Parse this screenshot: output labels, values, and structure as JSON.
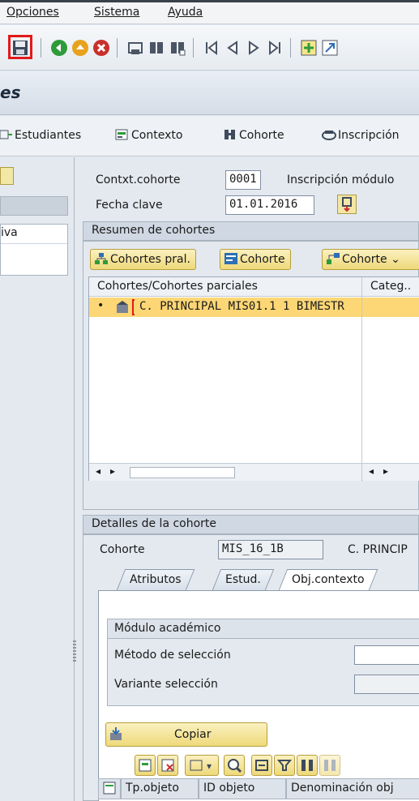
{
  "menu": {
    "items": [
      "Opciones",
      "Sistema",
      "Ayuda"
    ]
  },
  "title": {
    "text": "es"
  },
  "app_toolbar": {
    "estudiantes": "Estudiantes",
    "contexto": "Contexto",
    "cohorte": "Cohorte",
    "inscripcion": "Inscripción"
  },
  "left_pane": {
    "item": "iva"
  },
  "header": {
    "contxt_cohorte_label": "Contxt.cohorte",
    "contxt_cohorte_value": "0001",
    "inscripcion_modulo": "Inscripción módulo",
    "fecha_clave_label": "Fecha clave",
    "fecha_clave_value": "01.01.2016"
  },
  "resumen": {
    "title": "Resumen de cohortes",
    "buttons": {
      "cohortes_pral": "Cohortes pral.",
      "cohorte": "Cohorte",
      "cohorte2": "Cohorte"
    },
    "columns": [
      "Cohortes/Cohortes parciales",
      "Categ.."
    ],
    "row": "C. PRINCIPAL MIS01.1 1 BIMESTR"
  },
  "detalles": {
    "title": "Detalles de la cohorte",
    "cohorte_label": "Cohorte",
    "cohorte_value": "MIS_16_1B",
    "cohorte_desc": "C. PRINCIP",
    "tabs": [
      "Atributos",
      "Estud.",
      "Obj.contexto"
    ],
    "modulo_title": "Módulo académico",
    "metodo_label": "Método de selección",
    "variante_label": "Variante selección",
    "copiar": "Copiar",
    "grid_columns": [
      "Tp.objeto",
      "ID objeto",
      "Denominación obj"
    ]
  },
  "colors": {
    "accent": "#e11a1a",
    "selected_row": "#fdd775",
    "button": "#eed97a"
  }
}
